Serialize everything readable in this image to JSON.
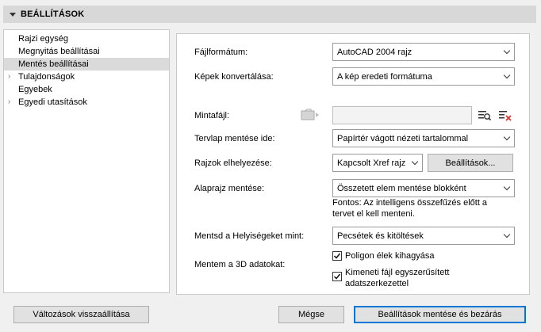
{
  "header": {
    "title": "BEÁLLÍTÁSOK"
  },
  "sidebar": {
    "items": [
      {
        "label": "Rajzi egység",
        "has_children": false
      },
      {
        "label": "Megnyitás beállításai",
        "has_children": false
      },
      {
        "label": "Mentés beállításai",
        "has_children": false,
        "selected": true
      },
      {
        "label": "Tulajdonságok",
        "has_children": true
      },
      {
        "label": "Egyebek",
        "has_children": false
      },
      {
        "label": "Egyedi utasítások",
        "has_children": true
      }
    ]
  },
  "form": {
    "file_format": {
      "label": "Fájlformátum:",
      "value": "AutoCAD 2004 rajz"
    },
    "image_convert": {
      "label": "Képek konvertálása:",
      "value": "A kép eredeti formátuma"
    },
    "template_file": {
      "label": "Mintafájl:",
      "value": ""
    },
    "layout_save": {
      "label": "Tervlap mentése ide:",
      "value": "Papírtér vágott nézeti tartalommal"
    },
    "drawing_placement": {
      "label": "Rajzok elhelyezése:",
      "value": "Kapcsolt Xref rajz",
      "settings_button": "Beállítások..."
    },
    "floorplan_save": {
      "label": "Alaprajz mentése:",
      "value": "Összetett elem mentése blokként"
    },
    "note": "Fontos: Az intelligens összefűzés előtt a tervet el kell menteni.",
    "save_locations": {
      "label": "Mentsd a Helyiségeket mint:",
      "value": "Pecsétek és kitöltések"
    },
    "save_3d": {
      "label": "Mentem a 3D adatokat:",
      "option1": {
        "label": "Poligon élek kihagyása",
        "checked": true
      },
      "option2": {
        "label": "Kimeneti fájl egyszerűsített adatszerkezettel",
        "checked": true
      }
    }
  },
  "footer": {
    "reset_button": "Változások visszaállítása",
    "cancel_button": "Mégse",
    "save_close_button": "Beállítások mentése és bezárás"
  },
  "icons": {
    "template_folder": "folder-arrow-icon",
    "browse": "browse-list-icon",
    "clear": "clear-x-icon"
  },
  "colors": {
    "accent_border": "#0078d7",
    "clear_icon_red": "#d9342b"
  }
}
